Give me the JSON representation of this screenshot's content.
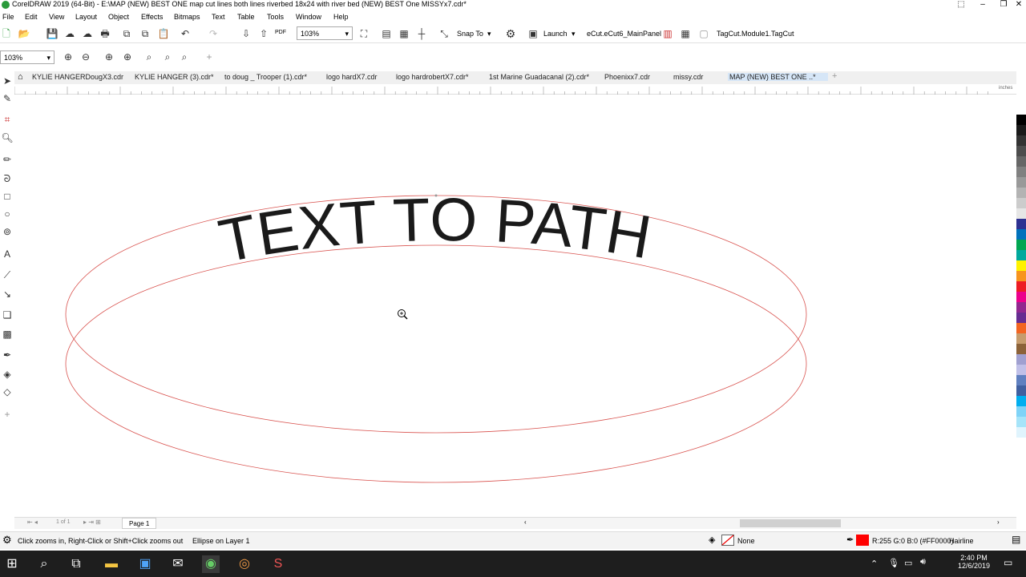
{
  "window": {
    "title": "CorelDRAW 2019 (64-Bit) - E:\\MAP (NEW) BEST ONE map cut lines both lines  riverbed 18x24 with river bed (NEW) BEST One MISSYx7.cdr*"
  },
  "menu": [
    "File",
    "Edit",
    "View",
    "Layout",
    "Object",
    "Effects",
    "Bitmaps",
    "Text",
    "Table",
    "Tools",
    "Window",
    "Help"
  ],
  "toolbar": {
    "zoom_value": "103%",
    "snap_label": "Snap To",
    "launch_label": "Launch",
    "ecut_label": "eCut.eCut6_MainPanel",
    "tagcut_label": "TagCut.Module1.TagCut",
    "pdf_label": "PDF"
  },
  "toolbar2": {
    "zoom_value": "103%"
  },
  "tabs": [
    "KYLIE HANGERDougX3.cdr",
    "KYLIE HANGER (3).cdr*",
    "to doug _ Trooper (1).cdr*",
    "logo hardX7.cdr",
    "logo hardrobertX7.cdr*",
    "1st Marine Guadacanal (2).cdr*",
    "Phoenixx7.cdr",
    "missy.cdr",
    "MAP (NEW) BEST ONE ..*"
  ],
  "ruler": {
    "unit": "inches"
  },
  "canvas": {
    "curved_text": "TEXT TO PATH",
    "stroke_color": "#d9534f"
  },
  "pagebar": {
    "page_label": "Page 1",
    "page_count": "1  of  1"
  },
  "status": {
    "hint": "Click zooms in, Right-Click or Shift+Click zooms out",
    "selection": "Ellipse on Layer 1",
    "fill": "None",
    "outline_color_text": "R:255 G:0 B:0 (#FF0000)",
    "outline_width": "Hairline"
  },
  "taskbar": {
    "time": "2:40 PM",
    "date": "12/6/2019"
  },
  "palette": [
    "#ffffff",
    "#000000",
    "#1a1a1a",
    "#333333",
    "#4d4d4d",
    "#666666",
    "#808080",
    "#999999",
    "#b3b3b3",
    "#cccccc",
    "#e6e6e6",
    "#2e3192",
    "#0072bc",
    "#00a651",
    "#00a99d",
    "#fff200",
    "#f7941d",
    "#ed1c24",
    "#ec008c",
    "#92278f",
    "#662d91",
    "#f26522",
    "#c69c6d",
    "#8c6239",
    "#a0a0d0",
    "#c0c0e8",
    "#6080c0",
    "#4060a0",
    "#00aeef",
    "#7fd3f7",
    "#a6e4f9",
    "#e0f4fd"
  ]
}
